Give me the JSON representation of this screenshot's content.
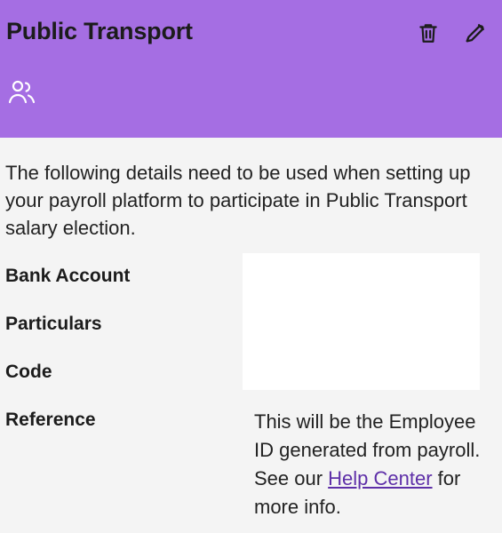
{
  "header": {
    "title": "Public Transport",
    "background_color": "#a56ee3",
    "delete_icon": "trash-icon",
    "edit_icon": "pencil-icon",
    "people_icon": "people-icon"
  },
  "content": {
    "description": "The following details need to be used when setting up your payroll platform to participate in Public Transport salary election.",
    "fields": {
      "bank_account_label": "Bank Account",
      "particulars_label": "Particulars",
      "code_label": "Code",
      "reference_label": "Reference"
    },
    "reference_info": {
      "text_before_link": "This will be the Employee ID generated from payroll. See our ",
      "link_text": "Help Center",
      "text_after_link": " for more info."
    }
  }
}
